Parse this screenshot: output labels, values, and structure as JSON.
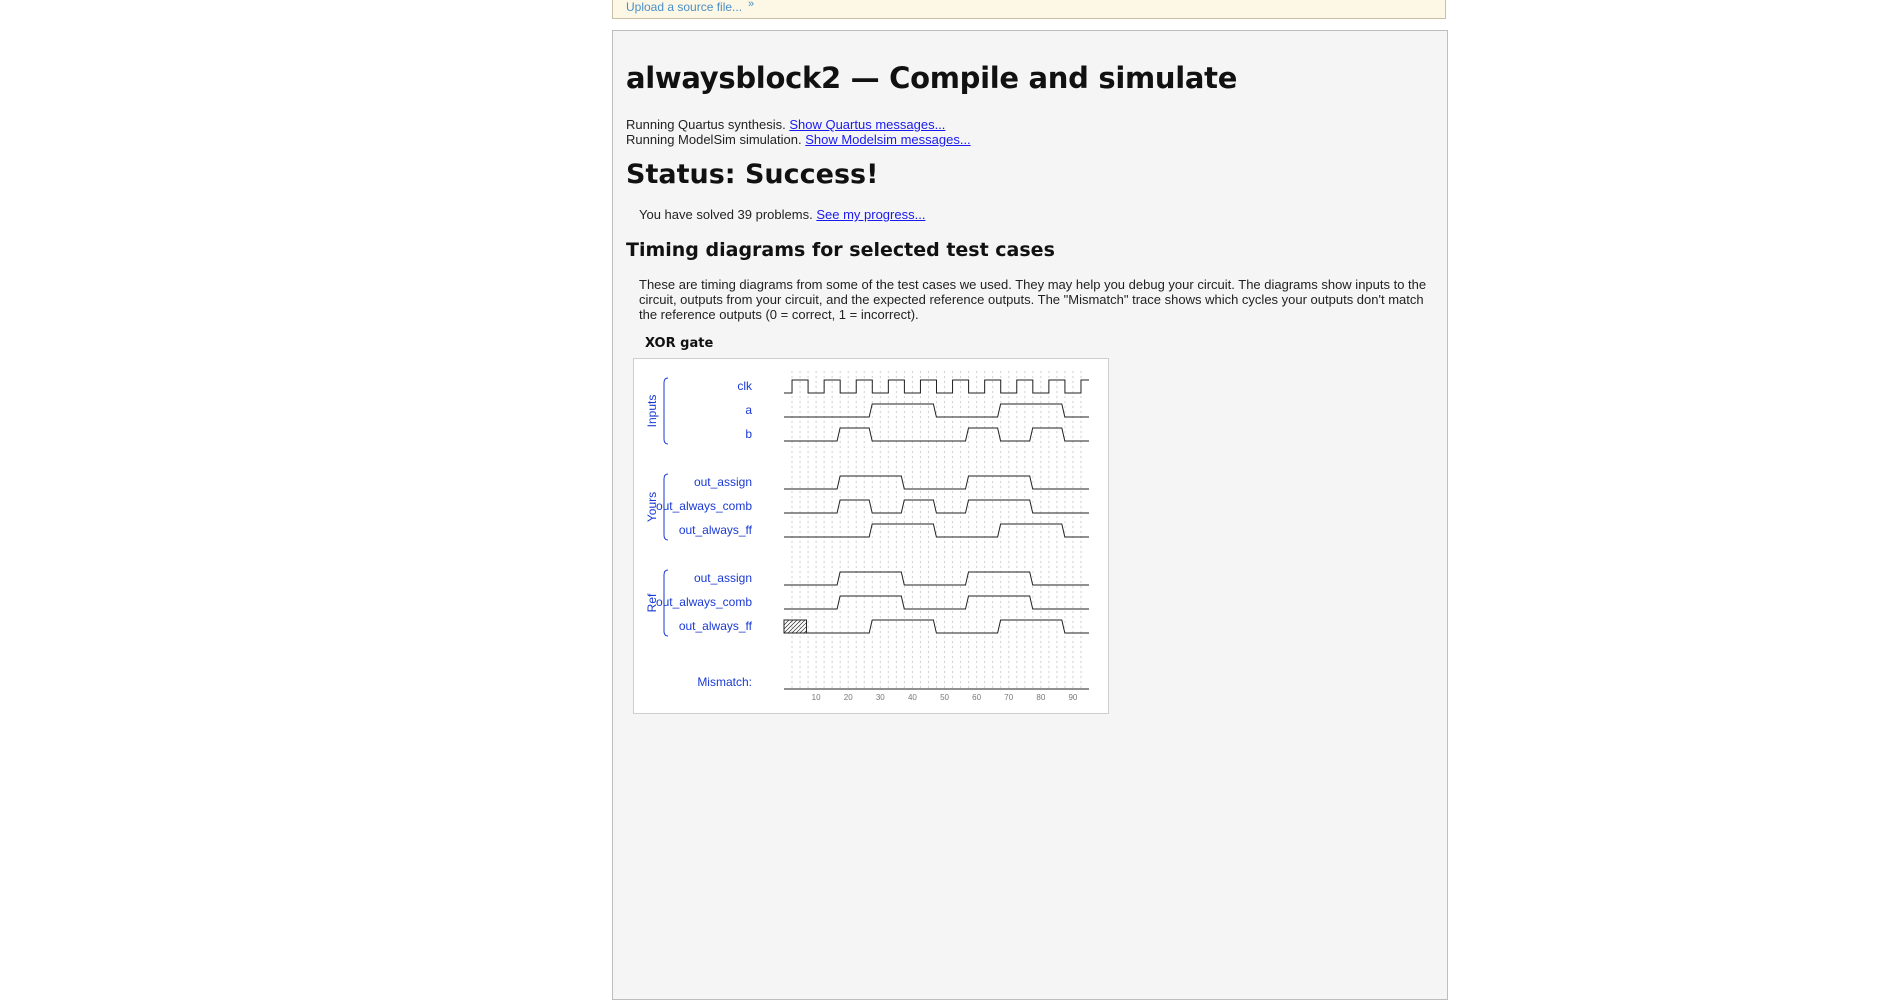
{
  "upload": {
    "label": "Upload a source file...",
    "chevron": "»"
  },
  "page": {
    "title": "alwaysblock2 — Compile and simulate",
    "quartus": {
      "text": "Running Quartus synthesis.",
      "link": "Show Quartus messages..."
    },
    "modelsim": {
      "text": "Running ModelSim simulation.",
      "link": "Show Modelsim messages..."
    },
    "status": "Status: Success!",
    "solved": {
      "text": "You have solved 39 problems.",
      "link": "See my progress..."
    },
    "timing_heading": "Timing diagrams for selected test cases",
    "timing_desc": "These are timing diagrams from some of the test cases we used. They may help you debug your circuit. The diagrams show inputs to the circuit, outputs from your circuit, and the expected reference outputs. The \"Mismatch\" trace shows which cycles your outputs don't match the reference outputs (0 = correct, 1 = incorrect).",
    "testcase_title": "XOR gate"
  },
  "waveform": {
    "time_ticks": [
      "10",
      "20",
      "30",
      "40",
      "50",
      "60",
      "70",
      "80",
      "90"
    ],
    "groups": [
      {
        "label": "Inputs",
        "signals": [
          {
            "name": "clk",
            "kind": "clock"
          },
          {
            "name": "a",
            "kind": "bit",
            "segments": [
              [
                0,
                0
              ],
              [
                27,
                1
              ],
              [
                47,
                0
              ],
              [
                67,
                1
              ],
              [
                87,
                0
              ]
            ]
          },
          {
            "name": "b",
            "kind": "bit",
            "segments": [
              [
                0,
                0
              ],
              [
                17,
                1
              ],
              [
                27,
                0
              ],
              [
                57,
                1
              ],
              [
                67,
                0
              ],
              [
                77,
                1
              ],
              [
                87,
                0
              ]
            ]
          }
        ]
      },
      {
        "label": "Yours",
        "signals": [
          {
            "name": "out_assign",
            "kind": "bit",
            "segments": [
              [
                0,
                0
              ],
              [
                17,
                1
              ],
              [
                37,
                0
              ],
              [
                57,
                1
              ],
              [
                77,
                0
              ]
            ]
          },
          {
            "name": "out_always_comb",
            "kind": "bit",
            "segments": [
              [
                0,
                0
              ],
              [
                17,
                1
              ],
              [
                27,
                0
              ],
              [
                37,
                1
              ],
              [
                47,
                0
              ],
              [
                57,
                1
              ],
              [
                77,
                0
              ]
            ]
          },
          {
            "name": "out_always_ff",
            "kind": "bit",
            "segments": [
              [
                0,
                0
              ],
              [
                27,
                1
              ],
              [
                47,
                0
              ],
              [
                67,
                1
              ],
              [
                87,
                0
              ]
            ]
          }
        ]
      },
      {
        "label": "Ref",
        "signals": [
          {
            "name": "out_assign",
            "kind": "bit",
            "segments": [
              [
                0,
                0
              ],
              [
                17,
                1
              ],
              [
                37,
                0
              ],
              [
                57,
                1
              ],
              [
                77,
                0
              ]
            ]
          },
          {
            "name": "out_always_comb",
            "kind": "bit",
            "segments": [
              [
                0,
                0
              ],
              [
                17,
                1
              ],
              [
                37,
                0
              ],
              [
                57,
                1
              ],
              [
                77,
                0
              ]
            ]
          },
          {
            "name": "out_always_ff",
            "kind": "bit",
            "undefined_until": 7,
            "segments": [
              [
                7,
                0
              ],
              [
                27,
                1
              ],
              [
                47,
                0
              ],
              [
                67,
                1
              ],
              [
                87,
                0
              ]
            ]
          }
        ]
      }
    ],
    "mismatch": {
      "name": "Mismatch:",
      "segments": [
        [
          0,
          0
        ]
      ]
    },
    "colors": {
      "signal": "#1a3ad6",
      "trace": "#222222",
      "grid": "#d0d0d0"
    }
  }
}
